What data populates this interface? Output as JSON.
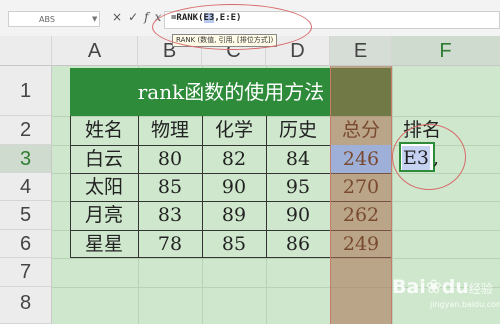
{
  "formula_bar": {
    "name_box": "ABS",
    "cancel_icon": "×",
    "enter_icon": "✓",
    "fx_icon": "fx",
    "formula_prefix": "=RANK(",
    "formula_ref": "E3",
    "formula_suffix": ",E:E)",
    "tooltip": "RANK (数值, 引用, [排位方式])"
  },
  "columns": [
    "A",
    "B",
    "C",
    "D",
    "E",
    "F"
  ],
  "rows": [
    "1",
    "2",
    "3",
    "4",
    "5",
    "6",
    "7",
    "8"
  ],
  "sheet": {
    "title": "rank函数的使用方法",
    "headers": [
      "姓名",
      "物理",
      "化学",
      "历史",
      "总分",
      "排名"
    ],
    "records": [
      {
        "name": "白云",
        "physics": "80",
        "chemistry": "82",
        "history": "84",
        "total": "246"
      },
      {
        "name": "太阳",
        "physics": "85",
        "chemistry": "90",
        "history": "95",
        "total": "270"
      },
      {
        "name": "月亮",
        "physics": "83",
        "chemistry": "89",
        "history": "90",
        "total": "262"
      },
      {
        "name": "星星",
        "physics": "78",
        "chemistry": "85",
        "history": "86",
        "total": "249"
      }
    ],
    "editing_cell": {
      "ref": "E3",
      "comma": ","
    }
  },
  "watermark": {
    "brand": "Bai",
    "brand_mid": "du",
    "brand_suffix": "经验",
    "sub": "jingyan.baidu.com"
  },
  "colors": {
    "accent_green": "#2e8b3a",
    "sheet_bg": "#cfe8cd",
    "column_highlight": "#aa6e50",
    "annotation": "#d86a6a"
  }
}
